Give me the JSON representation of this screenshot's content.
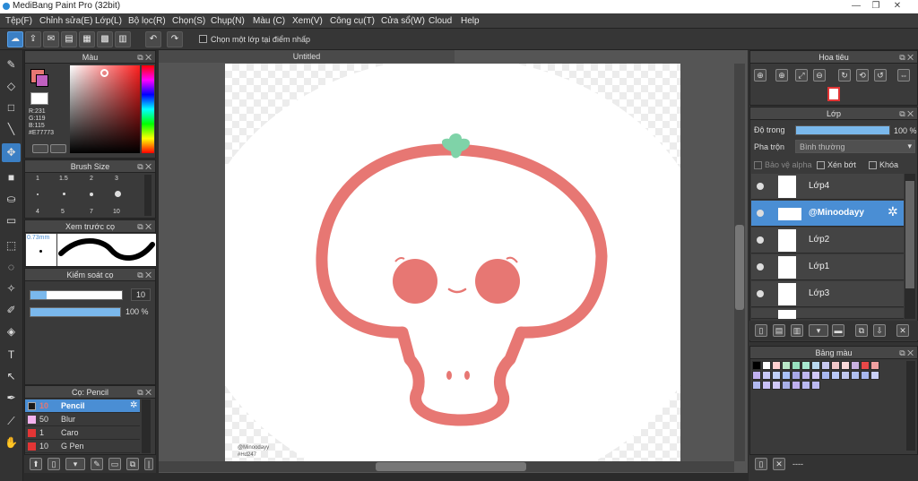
{
  "window": {
    "title": "MediBang Paint Pro (32bit)",
    "min": "—",
    "max": "❐",
    "close": "✕"
  },
  "menu": [
    "Tệp(F)",
    "Chỉnh sửa(E)",
    "Lớp(L)",
    "Bộ lọc(R)",
    "Chọn(S)",
    "Chụp(N)",
    "Màu (C)",
    "Xem(V)",
    "Công cụ(T)",
    "Cửa sổ(W)",
    "Cloud",
    "Help"
  ],
  "toolbar": {
    "checkbox_label": "Chọn một lớp tại điểm nhấp"
  },
  "color_panel": {
    "title": "Màu",
    "r": "R:231",
    "g": "G:119",
    "b": "B:115",
    "hex": "#E77773",
    "primary": "#e77773",
    "secondary": "#ffffff"
  },
  "brush_size": {
    "title": "Brush Size",
    "row1": [
      "1",
      "1.5",
      "2",
      "3"
    ],
    "row2": [
      "4",
      "5",
      "7",
      "10"
    ]
  },
  "brush_preview": {
    "title": "Xem trước cọ",
    "size": "0.73mm"
  },
  "brush_control": {
    "title": "Kiểm soát cọ",
    "size_value": "10",
    "opacity_value": "100 %"
  },
  "brush_list": {
    "title": "Cọ: Pencil",
    "items": [
      {
        "size": "10",
        "name": "Pencil",
        "color": "#1a1a1a"
      },
      {
        "size": "50",
        "name": "Blur",
        "color": "#f3b2ee"
      },
      {
        "size": "1",
        "name": "Caro",
        "color": "#e33535"
      },
      {
        "size": "10",
        "name": "G Pen",
        "color": "#e33535"
      }
    ]
  },
  "document": {
    "tab": "Untitled",
    "watermark_line1": "@Minoodayy",
    "watermark_line2": "#Hd247"
  },
  "navigator": {
    "title": "Hoa tiêu"
  },
  "layer_panel": {
    "title": "Lớp",
    "opacity_label": "Độ trong",
    "opacity_value": "100 %",
    "blend_label": "Pha trộn",
    "blend_value": "Bình thường",
    "protect_alpha": "Bảo vệ alpha",
    "clipping": "Xén bớt",
    "lock": "Khóa",
    "layers": [
      "Lớp4",
      "@Minoodayy",
      "Lớp2",
      "Lớp1",
      "Lớp3"
    ]
  },
  "palette": {
    "title": "Bảng màu",
    "footer": "----",
    "colors": [
      "#000000",
      "#ffffff",
      "#ffd0d0",
      "#b8e8c8",
      "#98e0c0",
      "#a8e8d0",
      "#b8d8f0",
      "#c8c8f0",
      "#f0c8c8",
      "#f8d8d8",
      "#c8b0e0",
      "#e84848",
      "#f0a0a0",
      "#c0b0f0",
      "#c8c8f8",
      "#c0d0f8",
      "#a8c0f8",
      "#a8a8e8",
      "#c0b8f0",
      "#d0c8f8",
      "#a8b8f0",
      "#b8c8f8",
      "#c0c8f0",
      "#b0c0f0",
      "#a8b8f0",
      "#c8d0f8",
      "#b0b8f0",
      "#c8c0f8",
      "#d0c8f8",
      "#a8b0e8",
      "#c0b0f0",
      "#b8b8f0",
      "#bab8f0"
    ]
  }
}
